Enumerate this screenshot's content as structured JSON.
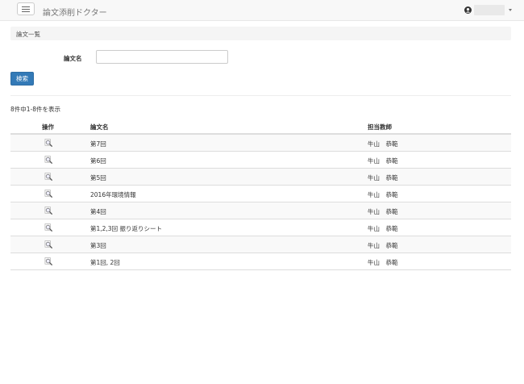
{
  "navbar": {
    "app_title": "論文添削ドクター",
    "menu_icon": "hamburger-icon",
    "user_icon": "user-icon",
    "dropdown_icon": "caret-down-icon"
  },
  "breadcrumb": {
    "label": "論文一覧"
  },
  "search_form": {
    "field_label": "論文名",
    "field_value": "",
    "field_placeholder": "",
    "search_label": "検索"
  },
  "results": {
    "count_text": "8件中1-8件を表示",
    "headers": {
      "action": "操作",
      "title": "論文名",
      "teacher": "担当教師"
    },
    "action_icon": "magnifier-icon",
    "rows": [
      {
        "title": "第7回",
        "teacher": "牛山　恭範"
      },
      {
        "title": "第6回",
        "teacher": "牛山　恭範"
      },
      {
        "title": "第5回",
        "teacher": "牛山　恭範"
      },
      {
        "title": "2016年環境情報",
        "teacher": "牛山　恭範"
      },
      {
        "title": "第4回",
        "teacher": "牛山　恭範"
      },
      {
        "title": "第1,2,3回 振り返りシート",
        "teacher": "牛山　恭範"
      },
      {
        "title": "第3回",
        "teacher": "牛山　恭範"
      },
      {
        "title": "第1回, 2回",
        "teacher": "牛山　恭範"
      }
    ]
  },
  "colors": {
    "primary": "#337ab7",
    "navbar_bg": "#f8f8f8",
    "stripe": "#f9f9f9"
  }
}
